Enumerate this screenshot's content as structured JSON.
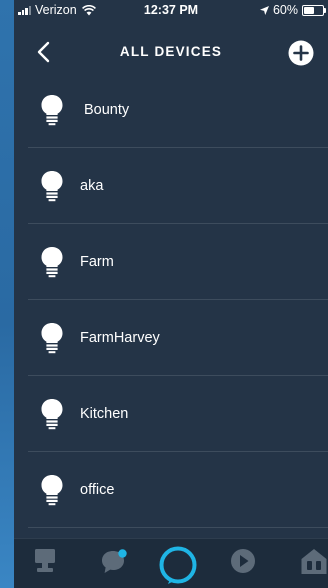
{
  "status_bar": {
    "carrier": "Verizon",
    "time": "12:37 PM",
    "battery": "60%",
    "battery_level": 0.6
  },
  "header": {
    "title": "ALL DEVICES",
    "back_icon": "chevron-left-icon",
    "add_icon": "plus-circle-icon"
  },
  "devices": [
    {
      "label": "Bounty",
      "icon": "light-bulb-icon"
    },
    {
      "label": "aka",
      "icon": "light-bulb-icon"
    },
    {
      "label": "Farm",
      "icon": "light-bulb-icon"
    },
    {
      "label": "FarmHarvey",
      "icon": "light-bulb-icon"
    },
    {
      "label": "Kitchen",
      "icon": "light-bulb-icon"
    },
    {
      "label": "office",
      "icon": "light-bulb-icon"
    }
  ],
  "bottom_nav": [
    {
      "name": "home",
      "icon": "home-icon"
    },
    {
      "name": "communicate",
      "icon": "chat-icon",
      "notification": true
    },
    {
      "name": "alexa",
      "icon": "alexa-ring-icon"
    },
    {
      "name": "play",
      "icon": "play-icon"
    },
    {
      "name": "devices",
      "icon": "smart-home-icon"
    }
  ],
  "colors": {
    "background": "#243447",
    "divider": "#3d4c5d",
    "accent": "#1fb5e5",
    "text": "#ffffff",
    "nav_icon": "#5d6b79"
  }
}
